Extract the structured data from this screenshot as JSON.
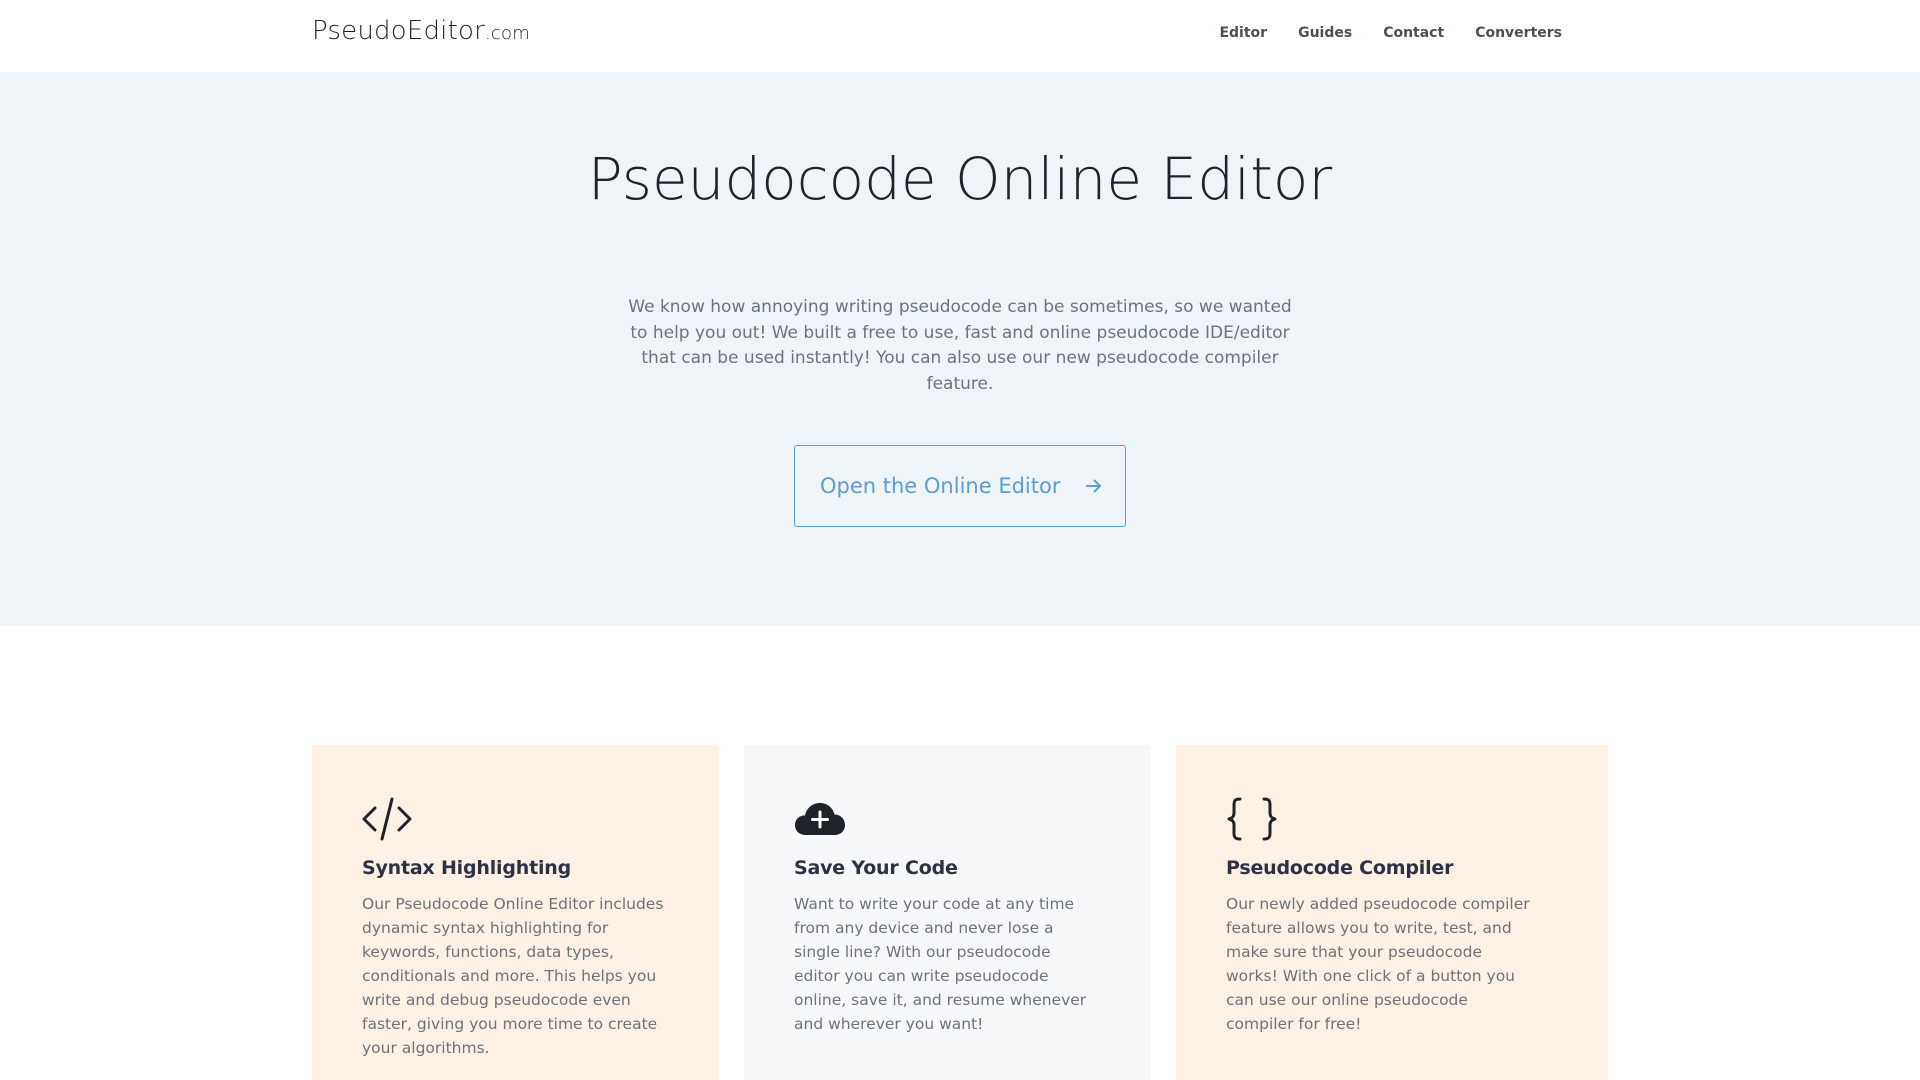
{
  "header": {
    "logo_main": "PseudoEditor",
    "logo_tld": ".com",
    "nav": [
      {
        "label": "Editor"
      },
      {
        "label": "Guides"
      },
      {
        "label": "Contact"
      },
      {
        "label": "Converters"
      }
    ]
  },
  "hero": {
    "title": "Pseudocode Online Editor",
    "description": "We know how annoying writing pseudocode can be sometimes, so we wanted to help you out! We built a free to use, fast and online pseudocode IDE/editor that can be used instantly! You can also use our new pseudocode compiler feature.",
    "cta_label": "Open the Online Editor",
    "cta_icon": "arrow-right-icon",
    "accent_color": "#5a9fd1",
    "background_color": "#eff4f8"
  },
  "features": [
    {
      "icon": "code-tag-icon",
      "title": "Syntax Highlighting",
      "text": "Our Pseudocode Online Editor includes dynamic syntax highlighting for keywords, functions, data types, conditionals and more. This helps you write and debug pseudocode even faster, giving you more time to create your algorithms.",
      "background": "#fdf0e4"
    },
    {
      "icon": "cloud-plus-icon",
      "title": "Save Your Code",
      "text": "Want to write your code at any time from any device and never lose a single line? With our pseudocode editor you can write pseudocode online, save it, and resume whenever and wherever you want!",
      "background": "#f6f8fa"
    },
    {
      "icon": "curly-braces-icon",
      "title": "Pseudocode Compiler",
      "text": "Our newly added pseudocode compiler feature allows you to write, test, and make sure that your pseudocode works! With one click of a button you can use our online pseudocode compiler for free!",
      "background": "#fdf0e4"
    }
  ]
}
